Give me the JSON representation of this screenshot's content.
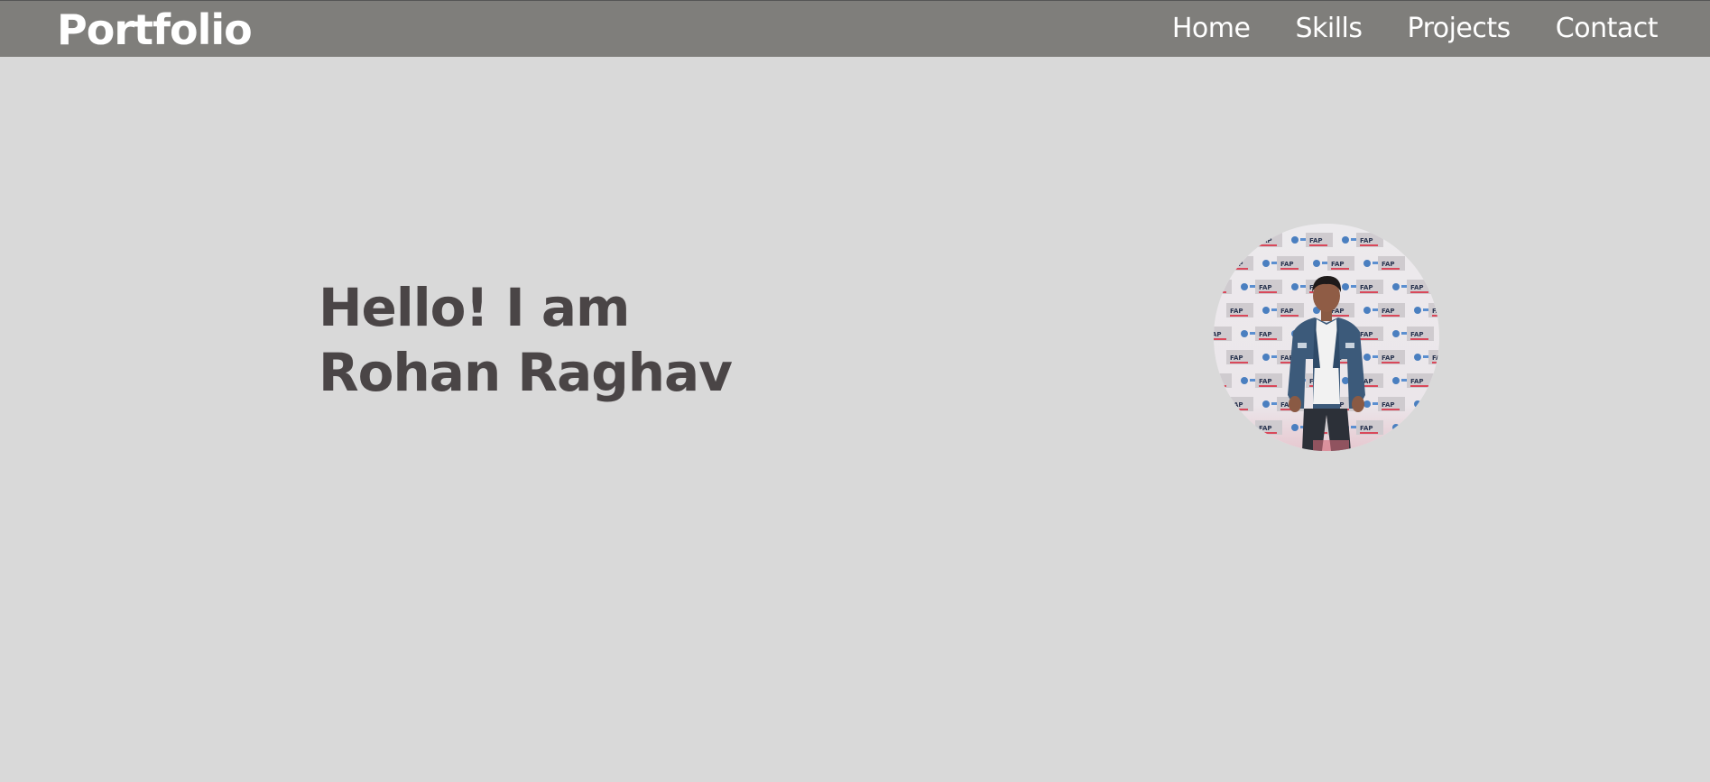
{
  "header": {
    "brand": "Portfolio",
    "nav": [
      {
        "label": "Home"
      },
      {
        "label": "Skills"
      },
      {
        "label": "Projects"
      },
      {
        "label": "Contact"
      }
    ]
  },
  "hero": {
    "line1": "Hello! I am",
    "line2": "Rohan Raghav"
  },
  "profile_photo": {
    "backdrop_text": "FAP"
  },
  "colors": {
    "navbar": "#7f7e7b",
    "background": "#d9d9d9",
    "heading": "#4a4546",
    "nav_text": "#ffffff"
  }
}
